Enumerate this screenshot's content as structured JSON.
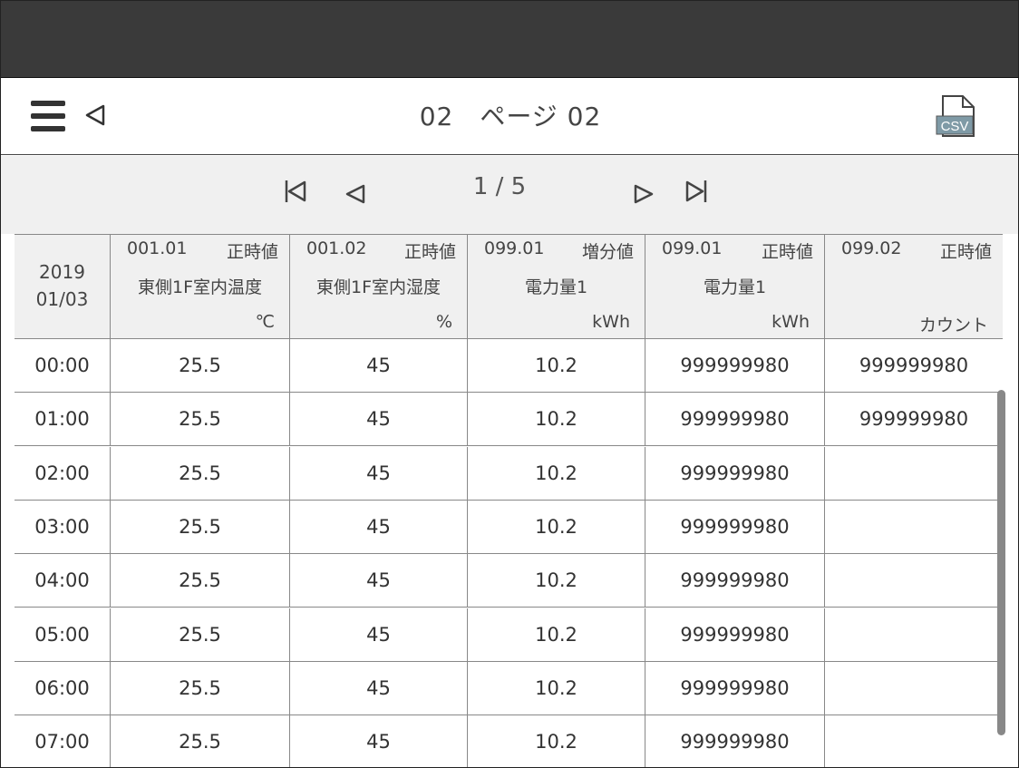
{
  "header": {
    "title": "02　ページ 02",
    "csv_label": "CSV"
  },
  "pager": {
    "label": "1 / 5"
  },
  "table": {
    "date": {
      "year": "2019",
      "day": "01/03"
    },
    "columns": [
      {
        "code": "001.01",
        "kind": "正時値",
        "name": "東側1F室内温度",
        "unit": "℃"
      },
      {
        "code": "001.02",
        "kind": "正時値",
        "name": "東側1F室内湿度",
        "unit": "%"
      },
      {
        "code": "099.01",
        "kind": "増分値",
        "name": "電力量1",
        "unit": "kWh"
      },
      {
        "code": "099.01",
        "kind": "正時値",
        "name": "電力量1",
        "unit": "kWh"
      },
      {
        "code": "099.02",
        "kind": "正時値",
        "name": "",
        "unit": "カウント"
      }
    ],
    "rows": [
      [
        "00:00",
        "25.5",
        "45",
        "10.2",
        "999999980",
        "999999980"
      ],
      [
        "01:00",
        "25.5",
        "45",
        "10.2",
        "999999980",
        "999999980"
      ],
      [
        "02:00",
        "25.5",
        "45",
        "10.2",
        "999999980",
        ""
      ],
      [
        "03:00",
        "25.5",
        "45",
        "10.2",
        "999999980",
        ""
      ],
      [
        "04:00",
        "25.5",
        "45",
        "10.2",
        "999999980",
        ""
      ],
      [
        "05:00",
        "25.5",
        "45",
        "10.2",
        "999999980",
        ""
      ],
      [
        "06:00",
        "25.5",
        "45",
        "10.2",
        "999999980",
        ""
      ],
      [
        "07:00",
        "25.5",
        "45",
        "10.2",
        "999999980",
        ""
      ]
    ]
  },
  "icons": {
    "menu": "hamburger-menu-icon",
    "back": "back-triangle-icon",
    "csv": "csv-file-icon",
    "first": "first-page-icon",
    "prev": "prev-page-icon",
    "next": "next-page-icon",
    "last": "last-page-icon"
  },
  "colors": {
    "topbar": "#3a3a3a",
    "pager_bg": "#f0f0f0",
    "grid": "#888888",
    "scrollbar": "#888888"
  }
}
